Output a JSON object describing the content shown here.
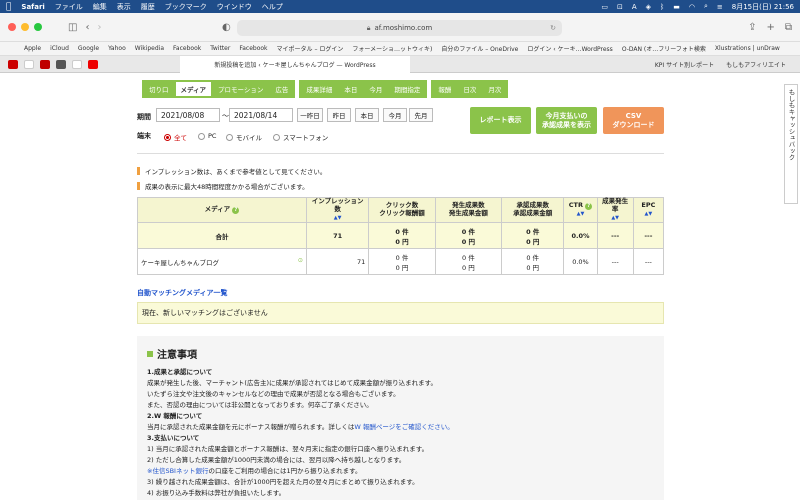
{
  "menubar": {
    "apple": "",
    "items": [
      "Safari",
      "ファイル",
      "編集",
      "表示",
      "履歴",
      "ブックマーク",
      "ウインドウ",
      "ヘルプ"
    ],
    "clock": "8月15日(日)  21:56"
  },
  "browser": {
    "url": "af.moshimo.com",
    "favorites": [
      "Apple",
      "iCloud",
      "Google",
      "Yahoo",
      "Wikipedia",
      "Facebook",
      "Twitter",
      "Facebook",
      "マイポータル – ログイン",
      "フォーメーショ…ットウィキ)",
      "自分のファイル – OneDrive",
      "ログイン ‹ ケーキ…WordPress",
      "O-DAN (オ…フリーフォト検索",
      "Xlustrations | unDraw"
    ],
    "active_tab": "新規投稿を追加 ‹ ケーキ屋しんちゃんブログ — WordPress",
    "right_tabs": [
      "KPI サイト別レポート",
      "もしもアフィリエイト"
    ]
  },
  "side_tab": "もしもキャッシュバック",
  "nav": {
    "group1": [
      "切り口",
      "メディア",
      "プロモーション",
      "広告"
    ],
    "group2": [
      "成果詳細",
      "本日",
      "今月",
      "期間指定"
    ],
    "group3": [
      "報酬",
      "日次",
      "月次"
    ]
  },
  "filter": {
    "period_label": "期間",
    "date_from": "2021/08/08",
    "sep": "～",
    "date_to": "2021/08/14",
    "quick": [
      "一昨日",
      "昨日",
      "本日",
      "今月",
      "先月"
    ],
    "device_label": "端末",
    "devices": [
      "全て",
      "PC",
      "モバイル",
      "スマートフォン"
    ]
  },
  "buttons": {
    "report": "レポート表示",
    "approved": "今月支払いの\n承認成果を表示",
    "csv": "CSV\nダウンロード"
  },
  "notes": [
    "インプレッション数は、あくまで参考値として見てください。",
    "成果の表示に最大48時間程度かかる場合がございます。"
  ],
  "table": {
    "headers": {
      "media": "メディア",
      "impressions": "インプレッション数",
      "clicks": "クリック数\nクリック報酬額",
      "occurred": "発生成果数\n発生成果金額",
      "approved": "承認成果数\n承認成果金額",
      "ctr": "CTR",
      "cvr": "成果発生率",
      "epc": "EPC"
    },
    "total": {
      "label": "合計",
      "impressions": "71",
      "clicks": "0 件",
      "click_amount": "0 円",
      "occ": "0 件",
      "occ_amount": "0 円",
      "app": "0 件",
      "app_amount": "0 円",
      "ctr": "0.0%",
      "cvr": "---",
      "epc": "---"
    },
    "rows": [
      {
        "media": "ケーキ屋しんちゃんブログ",
        "impressions": "71",
        "clicks": "0 件",
        "click_amount": "0 円",
        "occ": "0 件",
        "occ_amount": "0 円",
        "app": "0 件",
        "app_amount": "0 円",
        "ctr": "0.0%",
        "cvr": "---",
        "epc": "---"
      }
    ]
  },
  "auto_matching": {
    "title": "自動マッチングメディア一覧",
    "message": "現在、新しいマッチングはございません"
  },
  "notice": {
    "title": "注意事項",
    "lines": [
      {
        "t": "1.成果と承認について",
        "b": true
      },
      {
        "t": "成果が発生した後、マーチャント(広告主)に成果が承認されてはじめて成果金額が振り込まれます。",
        "b": false
      },
      {
        "t": "いたずら注文や注文後のキャンセルなどの理由で成果が否認となる場合もございます。",
        "b": false
      },
      {
        "t": "また、否認の理由については非公開となっております。何卒ご了承ください。",
        "b": false
      },
      {
        "t": "2.W 報酬について",
        "b": true
      },
      {
        "t": "当月に承認された成果金額を元にボーナス報酬が贈られます。詳しくは",
        "b": false,
        "link": "W 報酬ページをご確認ください。"
      },
      {
        "t": "3.支払いについて",
        "b": true
      },
      {
        "t": "1) 当月に承認された成果金額とボーナス報酬は、翌々月末に指定の銀行口座へ振り込まれます。",
        "b": false
      },
      {
        "t": "2) ただし合算した成果金額が1000円未満の場合には、翌月以降へ持ち越しとなります。",
        "b": false
      },
      {
        "t": "",
        "b": false,
        "link": "※住信SBIネット銀行",
        "after": "の口座をご利用の場合には1円から振り込まれます。"
      },
      {
        "t": "3) 繰り越された成果金額は、合計が1000円を超えた月の翌々月にまとめて振り込まれます。",
        "b": false
      },
      {
        "t": "4) お振り込み手数料は弊社が負担いたします。",
        "b": false
      }
    ]
  },
  "colors": {
    "menubar": "#1f4d8a",
    "green": "#8bc34a",
    "orange": "#f0955a"
  }
}
